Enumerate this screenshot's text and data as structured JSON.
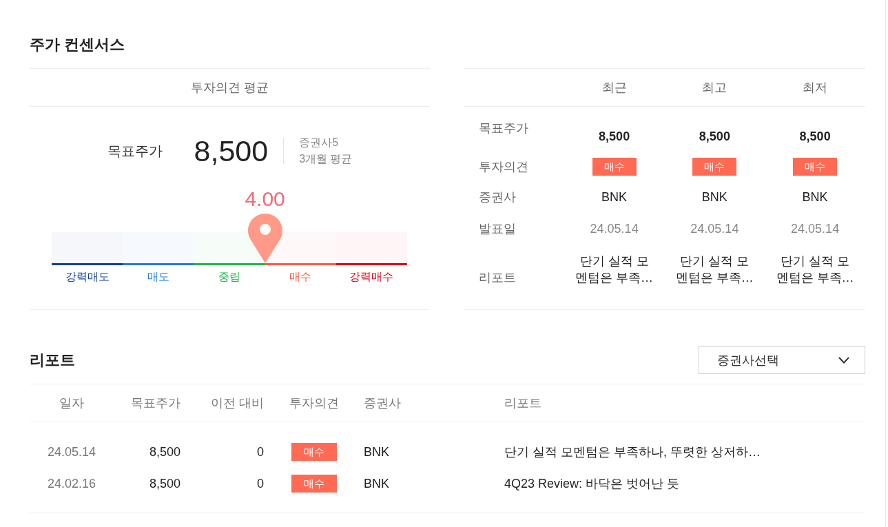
{
  "consensus": {
    "title": "주가 컨센서스",
    "average": {
      "header": "투자의견 평균",
      "target_price_label": "목표주가",
      "target_price": "8,500",
      "broker_count": "증권사5",
      "period": "3개월 평균",
      "score": "4.00",
      "level": 0.6,
      "scale": [
        {
          "label": "강력매도",
          "color": "#0f3fa0"
        },
        {
          "label": "매도",
          "color": "#1e7be6"
        },
        {
          "label": "중립",
          "color": "#1fb84a"
        },
        {
          "label": "매수",
          "color": "#ff5a44"
        },
        {
          "label": "강력매수",
          "color": "#e0001b"
        }
      ]
    },
    "summary": {
      "columns": [
        "최근",
        "최고",
        "최저"
      ],
      "rows": [
        {
          "label": "목표주가",
          "kind": "price",
          "values": [
            "8,500",
            "8,500",
            "8,500"
          ]
        },
        {
          "label": "투자의견",
          "kind": "opinion",
          "values": [
            "매수",
            "매수",
            "매수"
          ]
        },
        {
          "label": "증권사",
          "kind": "broker",
          "values": [
            "BNK",
            "BNK",
            "BNK"
          ]
        },
        {
          "label": "발표일",
          "kind": "date",
          "values": [
            "24.05.14",
            "24.05.14",
            "24.05.14"
          ]
        },
        {
          "label": "리포트",
          "kind": "report",
          "values": [
            "단기 실적 모멘텀은 부족…",
            "단기 실적 모멘텀은 부족…",
            "단기 실적 모멘텀은 부족…"
          ]
        }
      ]
    }
  },
  "reports": {
    "title": "리포트",
    "broker_select": {
      "value": "증권사선택"
    },
    "columns": [
      "일자",
      "목표주가",
      "이전 대비",
      "투자의견",
      "증권사",
      "리포트"
    ],
    "rows": [
      {
        "date": "24.05.14",
        "target_price": "8,500",
        "change": "0",
        "opinion": "매수",
        "broker": "BNK",
        "title": "단기 실적 모멘텀은 부족하나, 뚜렷한 상저하…"
      },
      {
        "date": "24.02.16",
        "target_price": "8,500",
        "change": "0",
        "opinion": "매수",
        "broker": "BNK",
        "title": "4Q23 Review: 바닥은 벗어난 듯"
      }
    ]
  }
}
